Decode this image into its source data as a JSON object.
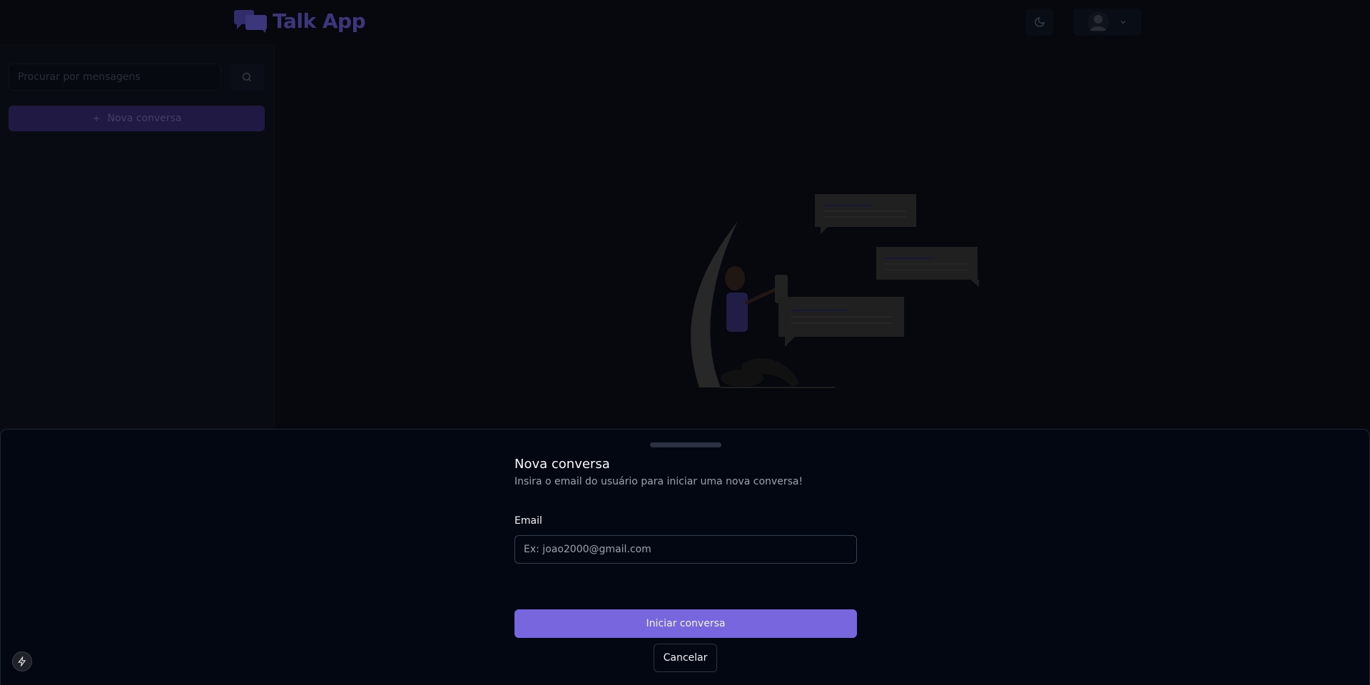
{
  "header": {
    "app_name": "Talk App",
    "logo_icon": "chat-bubbles-icon",
    "theme_icon": "moon-icon",
    "user_icon": "avatar-icon",
    "user_menu_icon": "chevron-down-icon",
    "brand_color": "#6d63e0"
  },
  "sidebar": {
    "search_placeholder": "Procurar por mensagens",
    "search_icon": "search-icon",
    "new_chat_label": "Nova conversa",
    "new_chat_icon": "plus-icon"
  },
  "main": {
    "illustration": "person-chatting-illustration"
  },
  "drawer": {
    "title": "Nova conversa",
    "description": "Insira o email do usuário para iniciar uma nova conversa!",
    "email_label": "Email",
    "email_placeholder": "Ex: joao2000@gmail.com",
    "email_value": "",
    "submit_label": "Iniciar conversa",
    "cancel_label": "Cancelar",
    "accent_color": "#7766dd"
  },
  "devtools": {
    "icon": "lightning-bolt-icon"
  }
}
